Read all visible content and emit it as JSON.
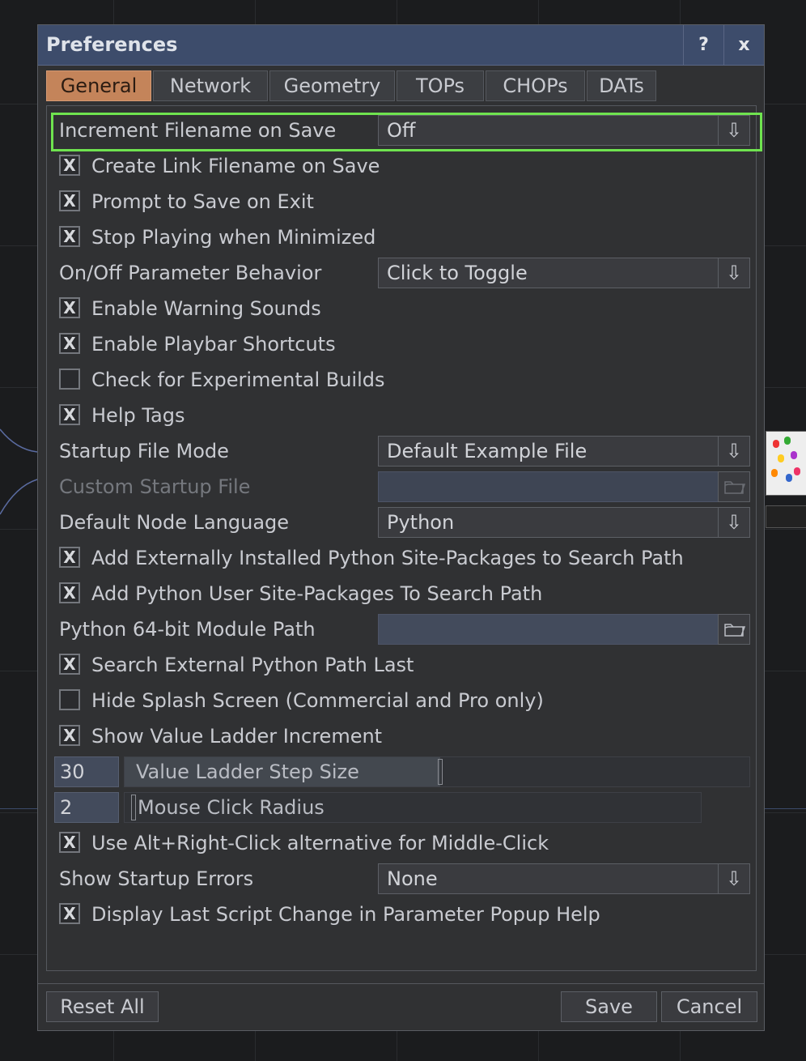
{
  "dialog": {
    "title": "Preferences",
    "help_label": "?",
    "close_label": "x"
  },
  "tabs": [
    {
      "label": "General",
      "active": true
    },
    {
      "label": "Network",
      "active": false
    },
    {
      "label": "Geometry",
      "active": false
    },
    {
      "label": "TOPs",
      "active": false
    },
    {
      "label": "CHOPs",
      "active": false
    },
    {
      "label": "DATs",
      "active": false
    }
  ],
  "rows": {
    "increment_filename": {
      "label": "Increment Filename on Save",
      "value": "Off"
    },
    "create_link": {
      "label": "Create Link Filename on Save",
      "checked": true
    },
    "prompt_save": {
      "label": "Prompt to Save on Exit",
      "checked": true
    },
    "stop_playing": {
      "label": "Stop Playing when Minimized",
      "checked": true
    },
    "onoff_behavior": {
      "label": "On/Off Parameter Behavior",
      "value": "Click to Toggle"
    },
    "warning_sounds": {
      "label": "Enable Warning Sounds",
      "checked": true
    },
    "playbar_shortcuts": {
      "label": "Enable Playbar Shortcuts",
      "checked": true
    },
    "experimental_builds": {
      "label": "Check for Experimental Builds",
      "checked": false
    },
    "help_tags": {
      "label": "Help Tags",
      "checked": true
    },
    "startup_file_mode": {
      "label": "Startup File Mode",
      "value": "Default Example File"
    },
    "custom_startup_file": {
      "label": "Custom Startup File",
      "value": ""
    },
    "default_node_language": {
      "label": "Default Node Language",
      "value": "Python"
    },
    "ext_site_packages": {
      "label": "Add Externally Installed Python Site-Packages to Search Path",
      "checked": true
    },
    "user_site_packages": {
      "label": "Add Python User Site-Packages To Search Path",
      "checked": true
    },
    "python_module_path": {
      "label": "Python 64-bit Module Path",
      "value": ""
    },
    "search_ext_last": {
      "label": "Search External Python Path Last",
      "checked": true
    },
    "hide_splash": {
      "label": "Hide Splash Screen (Commercial and Pro only)",
      "checked": false
    },
    "value_ladder_increment": {
      "label": "Show Value Ladder Increment",
      "checked": true
    },
    "ladder_step": {
      "label": "Value Ladder Step Size",
      "value": "30",
      "fraction": 0.5
    },
    "click_radius": {
      "label": "Mouse Click Radius",
      "value": "2",
      "fraction": 0.0
    },
    "alt_right_click": {
      "label": "Use Alt+Right-Click alternative for Middle-Click",
      "checked": true
    },
    "startup_errors": {
      "label": "Show Startup Errors",
      "value": "None"
    },
    "last_script_change": {
      "label": "Display Last Script Change in Parameter Popup Help",
      "checked": true
    }
  },
  "icons": {
    "checkmark": "X",
    "dropdown_arrow": "⇩"
  },
  "footer": {
    "reset_label": "Reset All",
    "save_label": "Save",
    "cancel_label": "Cancel"
  },
  "colors": {
    "title_bar": "#3d4c6b",
    "active_tab": "#c4845a",
    "highlight": "#6fe34f"
  }
}
